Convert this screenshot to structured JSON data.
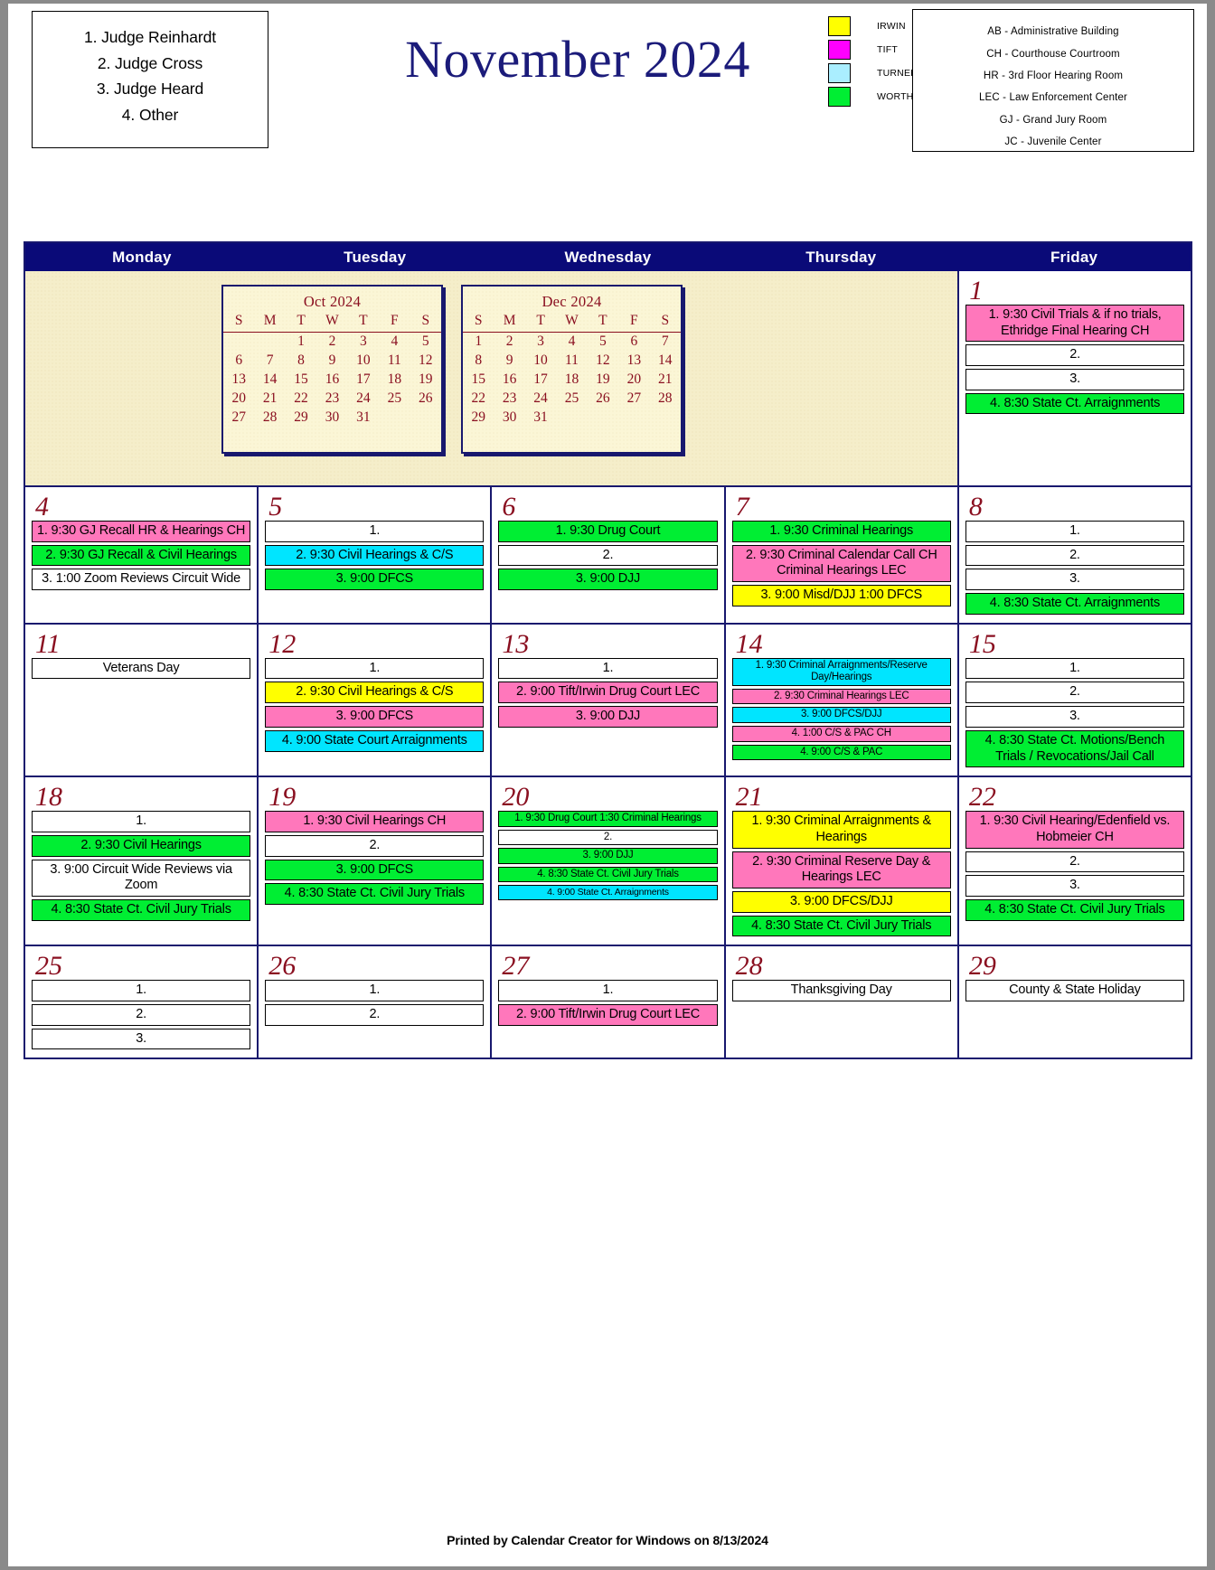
{
  "judges": {
    "items": [
      "1. Judge Reinhardt",
      "2. Judge Cross",
      "3. Judge Heard",
      "4. Other"
    ]
  },
  "title": "November 2024",
  "color_key": [
    {
      "label": "IRWIN",
      "color": "#ffff00"
    },
    {
      "label": "TIFT",
      "color": "#ff00ff"
    },
    {
      "label": "TURNER",
      "color": "#aaeeff"
    },
    {
      "label": "WORTH",
      "color": "#00ee33"
    }
  ],
  "abbreviations": [
    "AB - Administrative Building",
    "CH - Courthouse Courtroom",
    "HR - 3rd Floor Hearing Room",
    "LEC - Law Enforcement Center",
    "GJ - Grand Jury Room",
    "JC - Juvenile Center"
  ],
  "day_headers": [
    "Monday",
    "Tuesday",
    "Wednesday",
    "Thursday",
    "Friday"
  ],
  "mini_calendars": [
    {
      "title": "Oct 2024",
      "dow": [
        "S",
        "M",
        "T",
        "W",
        "T",
        "F",
        "S"
      ],
      "weeks": [
        [
          "",
          "",
          "1",
          "2",
          "3",
          "4",
          "5"
        ],
        [
          "6",
          "7",
          "8",
          "9",
          "10",
          "11",
          "12"
        ],
        [
          "13",
          "14",
          "15",
          "16",
          "17",
          "18",
          "19"
        ],
        [
          "20",
          "21",
          "22",
          "23",
          "24",
          "25",
          "26"
        ],
        [
          "27",
          "28",
          "29",
          "30",
          "31",
          "",
          ""
        ]
      ]
    },
    {
      "title": "Dec 2024",
      "dow": [
        "S",
        "M",
        "T",
        "W",
        "T",
        "F",
        "S"
      ],
      "weeks": [
        [
          "1",
          "2",
          "3",
          "4",
          "5",
          "6",
          "7"
        ],
        [
          "8",
          "9",
          "10",
          "11",
          "12",
          "13",
          "14"
        ],
        [
          "15",
          "16",
          "17",
          "18",
          "19",
          "20",
          "21"
        ],
        [
          "22",
          "23",
          "24",
          "25",
          "26",
          "27",
          "28"
        ],
        [
          "29",
          "30",
          "31",
          "",
          "",
          "",
          ""
        ]
      ]
    }
  ],
  "weeks": [
    {
      "days": [
        {
          "num": "1",
          "events": [
            {
              "text": "1. 9:30 Civil Trials & if no trials, Ethridge Final Hearing CH",
              "color": "#ff77bb"
            },
            {
              "text": "2.",
              "color": "#ffffff"
            },
            {
              "text": "3.",
              "color": "#ffffff"
            },
            {
              "text": "4. 8:30 State Ct. Arraignments",
              "color": "#00ee33"
            }
          ]
        }
      ]
    },
    {
      "days": [
        {
          "num": "4",
          "events": [
            {
              "text": "1. 9:30 GJ Recall HR & Hearings CH",
              "color": "#ff77bb"
            },
            {
              "text": "2. 9:30 GJ Recall & Civil Hearings",
              "color": "#00ee33"
            },
            {
              "text": "3. 1:00 Zoom Reviews Circuit Wide",
              "color": "#ffffff"
            }
          ]
        },
        {
          "num": "5",
          "events": [
            {
              "text": "1.",
              "color": "#ffffff"
            },
            {
              "text": "2. 9:30 Civil Hearings & C/S",
              "color": "#00e5ff"
            },
            {
              "text": "3. 9:00 DFCS",
              "color": "#00ee33"
            }
          ]
        },
        {
          "num": "6",
          "events": [
            {
              "text": "1. 9:30 Drug Court",
              "color": "#00ee33"
            },
            {
              "text": "2.",
              "color": "#ffffff"
            },
            {
              "text": "3. 9:00 DJJ",
              "color": "#00ee33"
            }
          ]
        },
        {
          "num": "7",
          "events": [
            {
              "text": "1. 9:30 Criminal Hearings",
              "color": "#00ee33"
            },
            {
              "text": "2. 9:30 Criminal Calendar Call CH Criminal Hearings LEC",
              "color": "#ff77bb"
            },
            {
              "text": "3. 9:00 Misd/DJJ 1:00 DFCS",
              "color": "#ffff00"
            }
          ]
        },
        {
          "num": "8",
          "events": [
            {
              "text": "1.",
              "color": "#ffffff"
            },
            {
              "text": "2.",
              "color": "#ffffff"
            },
            {
              "text": "3.",
              "color": "#ffffff"
            },
            {
              "text": "4. 8:30 State Ct. Arraignments",
              "color": "#00ee33"
            }
          ]
        }
      ]
    },
    {
      "days": [
        {
          "num": "11",
          "events": [
            {
              "text": "Veterans Day",
              "color": "#ffffff"
            }
          ]
        },
        {
          "num": "12",
          "events": [
            {
              "text": "1.",
              "color": "#ffffff"
            },
            {
              "text": "2. 9:30 Civil Hearings & C/S",
              "color": "#ffff00"
            },
            {
              "text": "3. 9:00 DFCS",
              "color": "#ff77bb"
            },
            {
              "text": "4. 9:00 State Court Arraignments",
              "color": "#00e5ff"
            }
          ]
        },
        {
          "num": "13",
          "events": [
            {
              "text": "1.",
              "color": "#ffffff"
            },
            {
              "text": "2. 9:00 Tift/Irwin Drug Court LEC",
              "color": "#ff77bb"
            },
            {
              "text": "3. 9:00 DJJ",
              "color": "#ff77bb"
            }
          ]
        },
        {
          "num": "14",
          "events": [
            {
              "text": "1. 9:30 Criminal Arraignments/Reserve Day/Hearings",
              "color": "#00e5ff",
              "size": "small"
            },
            {
              "text": "2. 9:30 Criminal Hearings LEC",
              "color": "#ff77bb",
              "size": "small"
            },
            {
              "text": "3. 9:00 DFCS/DJJ",
              "color": "#00e5ff",
              "size": "small"
            },
            {
              "text": "4. 1:00 C/S & PAC CH",
              "color": "#ff77bb",
              "size": "small"
            },
            {
              "text": "4. 9:00 C/S & PAC",
              "color": "#00ee33",
              "size": "small"
            }
          ]
        },
        {
          "num": "15",
          "events": [
            {
              "text": "1.",
              "color": "#ffffff"
            },
            {
              "text": "2.",
              "color": "#ffffff"
            },
            {
              "text": "3.",
              "color": "#ffffff"
            },
            {
              "text": "4. 8:30 State Ct. Motions/Bench Trials / Revocations/Jail Call",
              "color": "#00ee33"
            }
          ]
        }
      ]
    },
    {
      "days": [
        {
          "num": "18",
          "events": [
            {
              "text": "1.",
              "color": "#ffffff"
            },
            {
              "text": "2. 9:30 Civil Hearings",
              "color": "#00ee33"
            },
            {
              "text": "3. 9:00 Circuit Wide Reviews via Zoom",
              "color": "#ffffff"
            },
            {
              "text": "4. 8:30 State Ct. Civil Jury Trials",
              "color": "#00ee33"
            }
          ]
        },
        {
          "num": "19",
          "events": [
            {
              "text": "1. 9:30 Civil Hearings CH",
              "color": "#ff77bb"
            },
            {
              "text": "2.",
              "color": "#ffffff"
            },
            {
              "text": "3. 9:00 DFCS",
              "color": "#00ee33"
            },
            {
              "text": "4. 8:30 State Ct. Civil Jury Trials",
              "color": "#00ee33"
            }
          ]
        },
        {
          "num": "20",
          "events": [
            {
              "text": "1. 9:30 Drug Court 1:30 Criminal Hearings",
              "color": "#00ee33",
              "size": "small"
            },
            {
              "text": "2.",
              "color": "#ffffff",
              "size": "small"
            },
            {
              "text": "3. 9:00 DJJ",
              "color": "#00ee33",
              "size": "small"
            },
            {
              "text": "4.  8:30 State Ct. Civil Jury Trials",
              "color": "#00ee33",
              "size": "small"
            },
            {
              "text": "4. 9:00 State Ct. Arraignments",
              "color": "#00e5ff",
              "size": "tiny"
            }
          ]
        },
        {
          "num": "21",
          "events": [
            {
              "text": "1. 9:30 Criminal Arraignments & Hearings",
              "color": "#ffff00"
            },
            {
              "text": "2. 9:30 Criminal Reserve Day & Hearings LEC",
              "color": "#ff77bb"
            },
            {
              "text": "3. 9:00 DFCS/DJJ",
              "color": "#ffff00"
            },
            {
              "text": "4. 8:30 State Ct. Civil Jury Trials",
              "color": "#00ee33"
            }
          ]
        },
        {
          "num": "22",
          "events": [
            {
              "text": "1. 9:30 Civil Hearing/Edenfield vs. Hobmeier CH",
              "color": "#ff77bb"
            },
            {
              "text": "2.",
              "color": "#ffffff"
            },
            {
              "text": "3.",
              "color": "#ffffff"
            },
            {
              "text": "4. 8:30 State Ct. Civil Jury Trials",
              "color": "#00ee33"
            }
          ]
        }
      ]
    },
    {
      "days": [
        {
          "num": "25",
          "events": [
            {
              "text": "1.",
              "color": "#ffffff"
            },
            {
              "text": "2.",
              "color": "#ffffff"
            },
            {
              "text": "3.",
              "color": "#ffffff"
            }
          ]
        },
        {
          "num": "26",
          "events": [
            {
              "text": "1.",
              "color": "#ffffff"
            },
            {
              "text": "2.",
              "color": "#ffffff"
            }
          ]
        },
        {
          "num": "27",
          "events": [
            {
              "text": "1.",
              "color": "#ffffff"
            },
            {
              "text": "2. 9:00 Tift/Irwin Drug Court LEC",
              "color": "#ff77bb"
            }
          ]
        },
        {
          "num": "28",
          "events": [
            {
              "text": "Thanksgiving Day",
              "color": "#ffffff"
            }
          ]
        },
        {
          "num": "29",
          "events": [
            {
              "text": "County & State Holiday",
              "color": "#ffffff"
            }
          ]
        }
      ]
    }
  ],
  "footer": "Printed by Calendar Creator for Windows on 8/13/2024"
}
